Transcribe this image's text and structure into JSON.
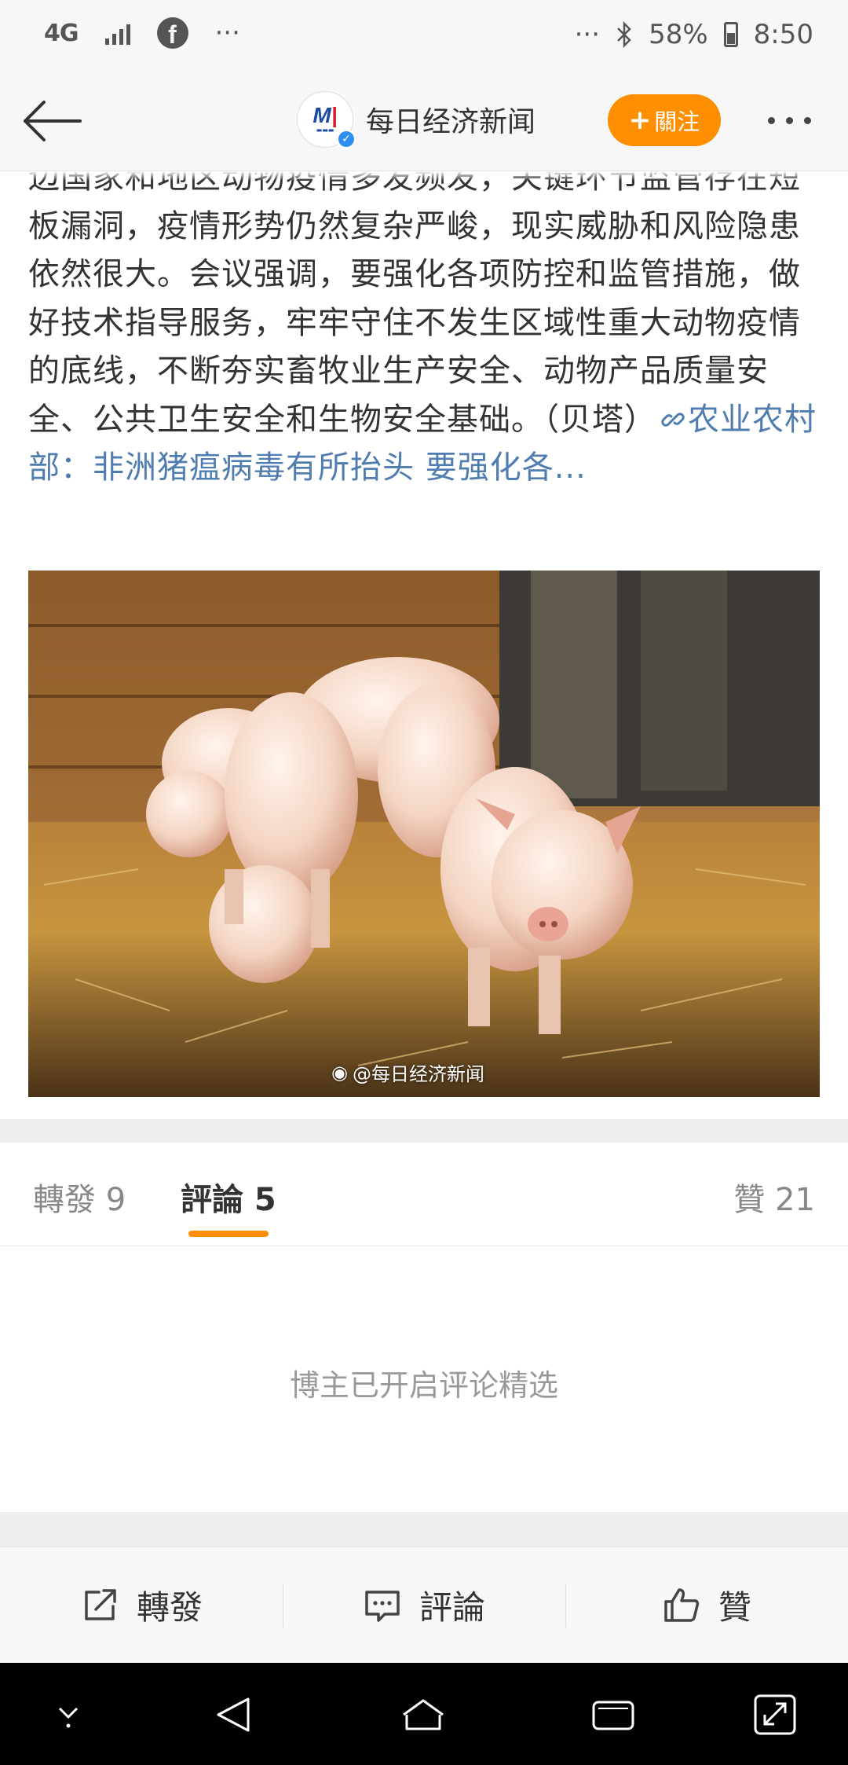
{
  "status_bar": {
    "network": "4G",
    "overflow_left": "···",
    "overflow_right": "···",
    "battery": "58%",
    "time": "8:50"
  },
  "header": {
    "account_name": "每日经济新闻",
    "follow_label": "關注",
    "follow_plus": "+"
  },
  "post": {
    "text": "边国家和地区动物疫情多发频发，关键环节监管存在短板漏洞，疫情形势仍然复杂严峻，现实威胁和风险隐患依然很大。会议强调，要强化各项防控和监管措施，做好技术指导服务，牢牢守住不发生区域性重大动物疫情的底线，不断夯实畜牧业生产安全、动物产品质量安全、公共卫生安全和生物安全基础。（贝塔）",
    "link_text": "农业农村部：非洲猪瘟病毒有所抬头 要强化各...",
    "image_watermark": "@每日经济新闻"
  },
  "tabs": {
    "repost": "轉發 9",
    "comment": "評論 5",
    "like": "贊 21"
  },
  "comment_note": "博主已开启评论精选",
  "actions": {
    "repost": "轉發",
    "comment": "評論",
    "like": "贊"
  },
  "colors": {
    "accent": "#ff8f00",
    "link": "#507daf"
  }
}
